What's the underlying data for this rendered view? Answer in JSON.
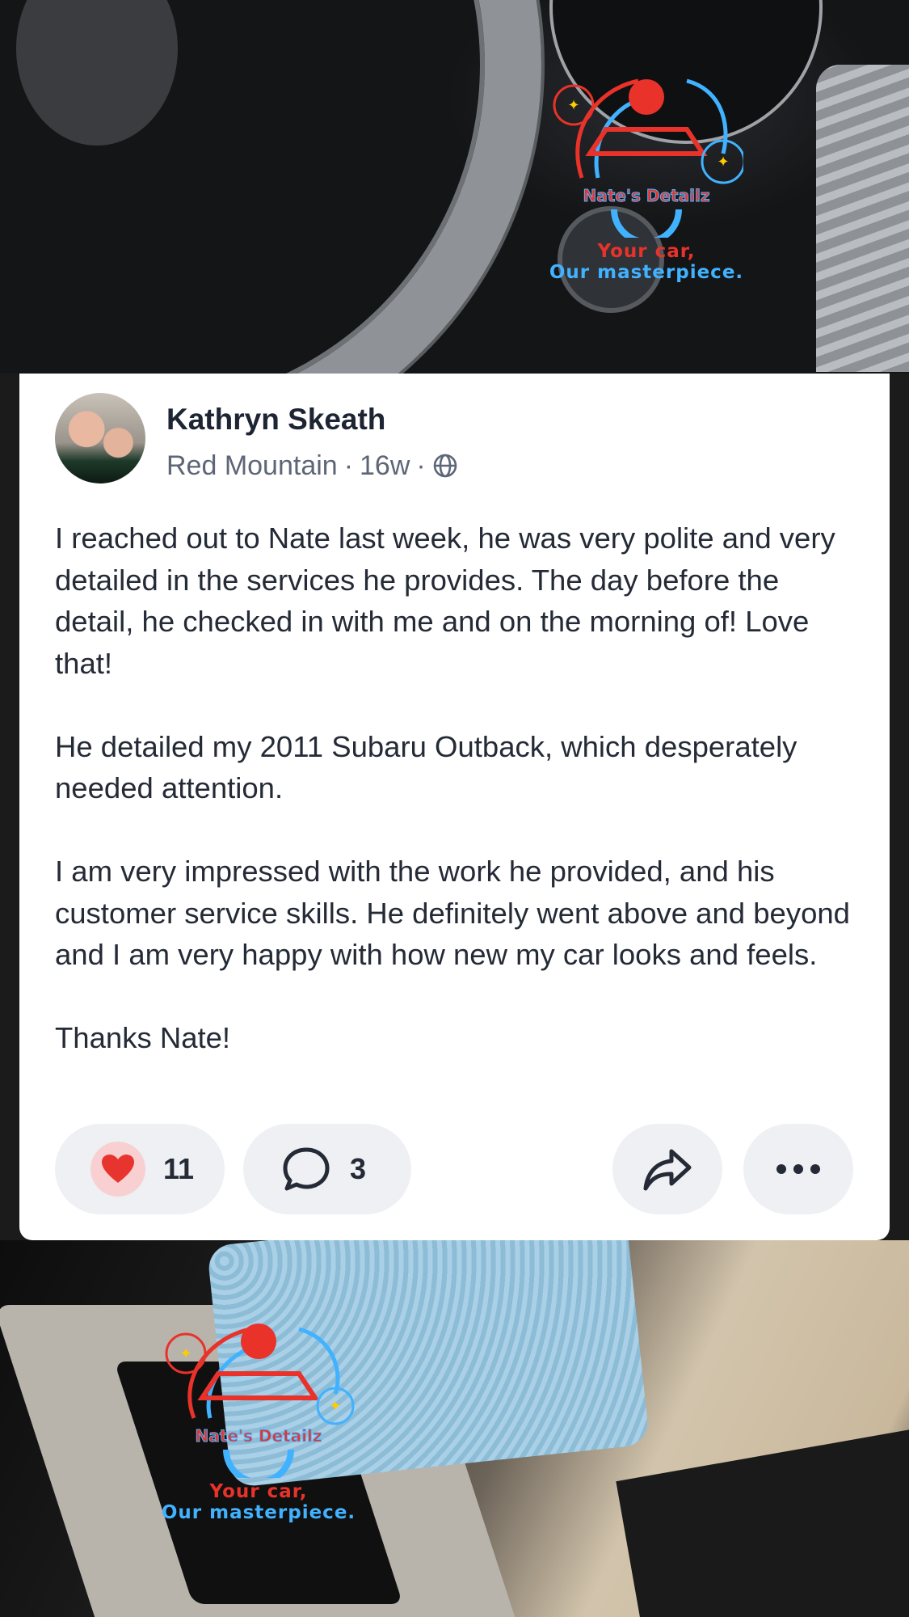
{
  "logo_top": {
    "brand": "Nate's Detailz",
    "tagline_1": "Your car,",
    "tagline_2": "Our masterpiece."
  },
  "logo_bottom": {
    "brand": "Nate's Detailz",
    "tagline_1": "Your car,",
    "tagline_2": "Our masterpiece."
  },
  "post": {
    "author": "Kathryn Skeath",
    "location": "Red Mountain",
    "separator": "·",
    "time": "16w",
    "visibility_icon": "globe-icon",
    "paragraphs": [
      "I reached out to Nate last week, he was very polite and very detailed in the services he provides. The day before the detail, he checked in with me and on the morning of! Love that!",
      "He detailed my 2011 Subaru Outback, which desperately needed attention.",
      "I am very impressed with the work he provided, and his customer service skills. He definitely went above and beyond and I am very happy with how new my car looks and feels.",
      "Thanks Nate!"
    ]
  },
  "actions": {
    "like_count": "11",
    "comment_count": "3",
    "like_icon": "heart-icon",
    "comment_icon": "speech-bubble-icon",
    "share_icon": "share-arrow-icon",
    "more_icon": "more-dots-icon",
    "heart_color": "#e8342e"
  }
}
